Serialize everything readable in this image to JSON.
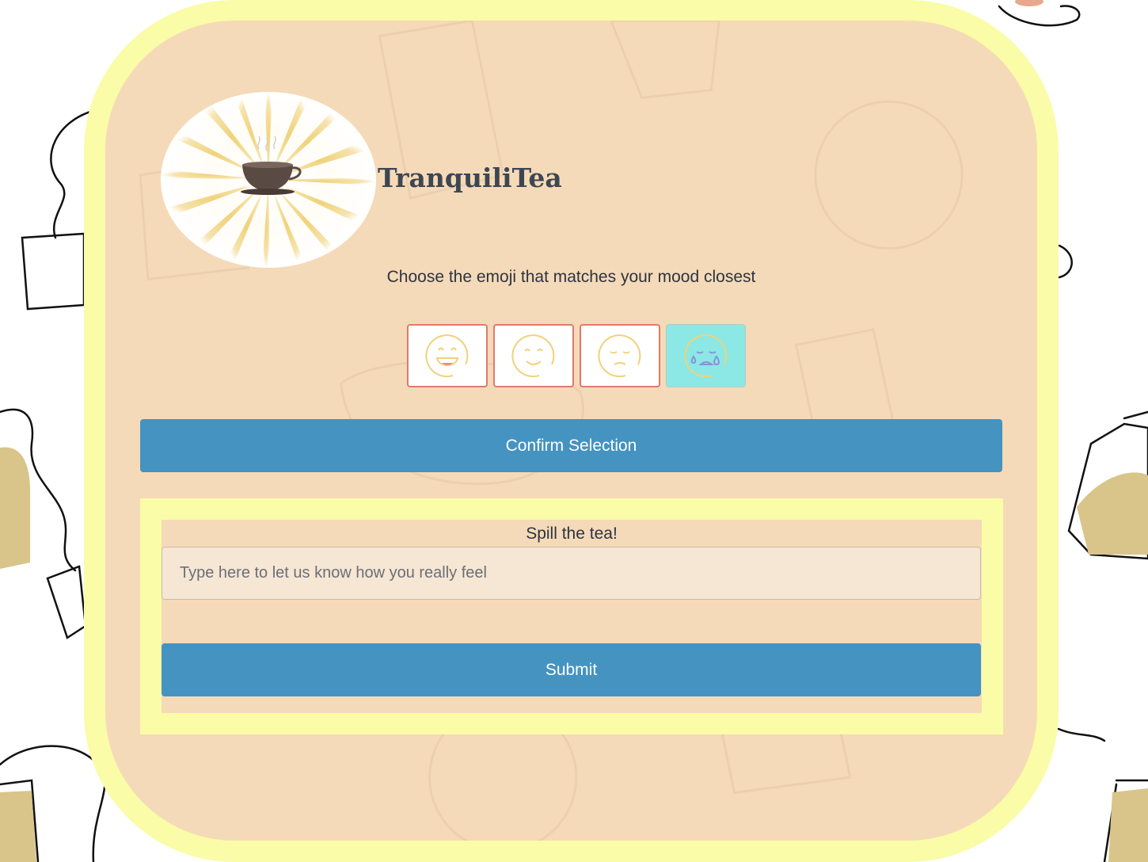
{
  "brand": {
    "name": "TranquiliTea",
    "logo_icon": "teacup-sunburst-icon"
  },
  "mood": {
    "prompt": "Choose the emoji that matches your mood closest",
    "options": [
      {
        "name": "very-happy-emoji-icon",
        "selected": false
      },
      {
        "name": "happy-emoji-icon",
        "selected": false
      },
      {
        "name": "sad-emoji-icon",
        "selected": false
      },
      {
        "name": "crying-emoji-icon",
        "selected": true
      }
    ],
    "confirm_label": "Confirm Selection"
  },
  "feedback": {
    "label": "Spill the tea!",
    "placeholder": "Type here to let us know how you really feel",
    "value": "",
    "submit_label": "Submit"
  },
  "colors": {
    "card_bg": "#f5dab9",
    "card_border": "#fafca7",
    "button": "#4593c1",
    "emoji_border": "#e07a6a",
    "selected_emoji_bg": "#8be8e4",
    "emoji_stroke": "#f0d27a"
  }
}
